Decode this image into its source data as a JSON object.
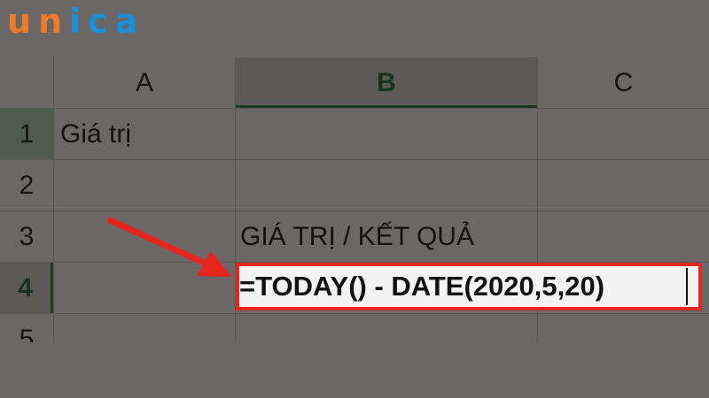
{
  "brand": {
    "letters": [
      "u",
      "n",
      "i",
      "c",
      "a"
    ],
    "colors": [
      "#f07a2a",
      "#f07a2a",
      "#1a8fd8",
      "#1a8fd8",
      "#1a8fd8"
    ]
  },
  "columns": [
    "A",
    "B",
    "C"
  ],
  "rows": [
    "1",
    "2",
    "3",
    "4",
    "5"
  ],
  "active_column": "B",
  "active_row": "4",
  "cells": {
    "A1": "Giá trị",
    "B3": "GIÁ TRỊ / KẾT QUẢ",
    "B4": "=TODAY() - DATE(2020,5,20)"
  },
  "colors": {
    "highlight_border": "#e6251f",
    "arrow": "#e6251f",
    "active_header": "#1e3b22"
  },
  "icons": [
    "red-arrow-icon"
  ]
}
